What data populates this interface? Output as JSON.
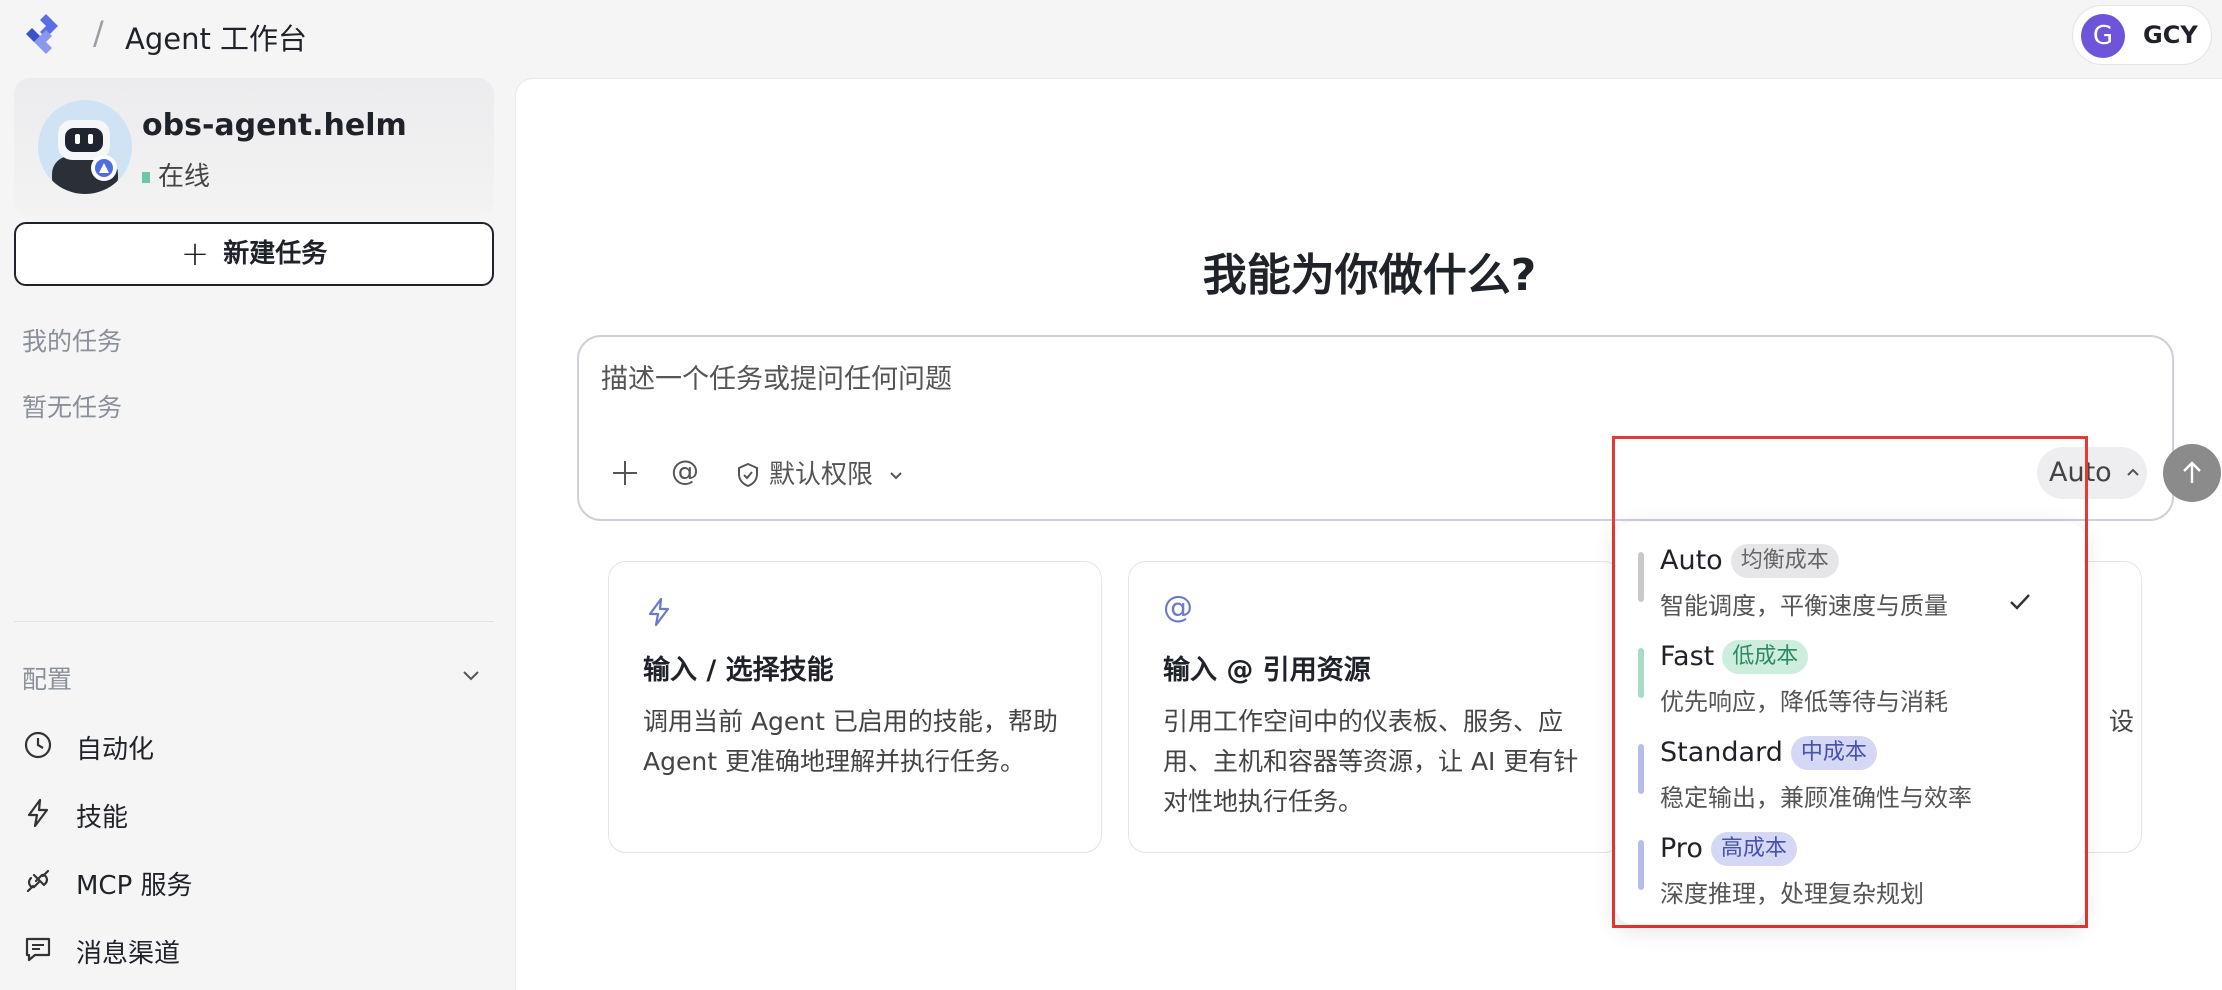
{
  "header": {
    "separator": "/",
    "title": "Agent 工作台",
    "user": {
      "initial": "G",
      "name": "GCY"
    }
  },
  "sidebar": {
    "agent": {
      "name": "obs-agent.helm",
      "status": "在线"
    },
    "new_task_label": "新建任务",
    "my_tasks_label": "我的任务",
    "no_tasks_label": "暂无任务",
    "config_label": "配置",
    "nav": [
      {
        "label": "自动化",
        "icon": "clock-icon"
      },
      {
        "label": "技能",
        "icon": "lightning-icon"
      },
      {
        "label": "MCP 服务",
        "icon": "plug-icon"
      },
      {
        "label": "消息渠道",
        "icon": "message-icon"
      }
    ]
  },
  "main": {
    "title": "我能为你做什么?",
    "composer": {
      "placeholder": "描述一个任务或提问任何问题",
      "at_symbol": "@",
      "permission_label": "默认权限",
      "model_label": "Auto"
    },
    "cards": [
      {
        "icon": "lightning-icon",
        "title": "输入 / 选择技能",
        "desc": "调用当前 Agent 已启用的技能，帮助 Agent 更准确地理解并执行任务。"
      },
      {
        "icon": "at-icon",
        "title": "输入 @ 引用资源",
        "desc": "引用工作空间中的仪表板、服务、应用、主机和容器等资源，让 AI 更有针对性地执行任务。"
      },
      {
        "icon": "",
        "title": "",
        "desc": "设"
      }
    ]
  },
  "model_menu": {
    "options": [
      {
        "name": "Auto",
        "badge": "均衡成本",
        "desc": "智能调度，平衡速度与质量",
        "bar_color": "#c9c9cc",
        "badge_bg": "#e6e6e8",
        "badge_fg": "#666666",
        "selected": true
      },
      {
        "name": "Fast",
        "badge": "低成本",
        "desc": "优先响应，降低等待与消耗",
        "bar_color": "#a8dcc4",
        "badge_bg": "#cdeedd",
        "badge_fg": "#2f8a5f",
        "selected": false
      },
      {
        "name": "Standard",
        "badge": "中成本",
        "desc": "稳定输出，兼顾准确性与效率",
        "bar_color": "#b6bde9",
        "badge_bg": "#d4d8f4",
        "badge_fg": "#4753a8",
        "selected": false
      },
      {
        "name": "Pro",
        "badge": "高成本",
        "desc": "深度推理，处理复杂规划",
        "bar_color": "#b6bde9",
        "badge_bg": "#d4d8f4",
        "badge_fg": "#4753a8",
        "selected": false
      }
    ]
  }
}
